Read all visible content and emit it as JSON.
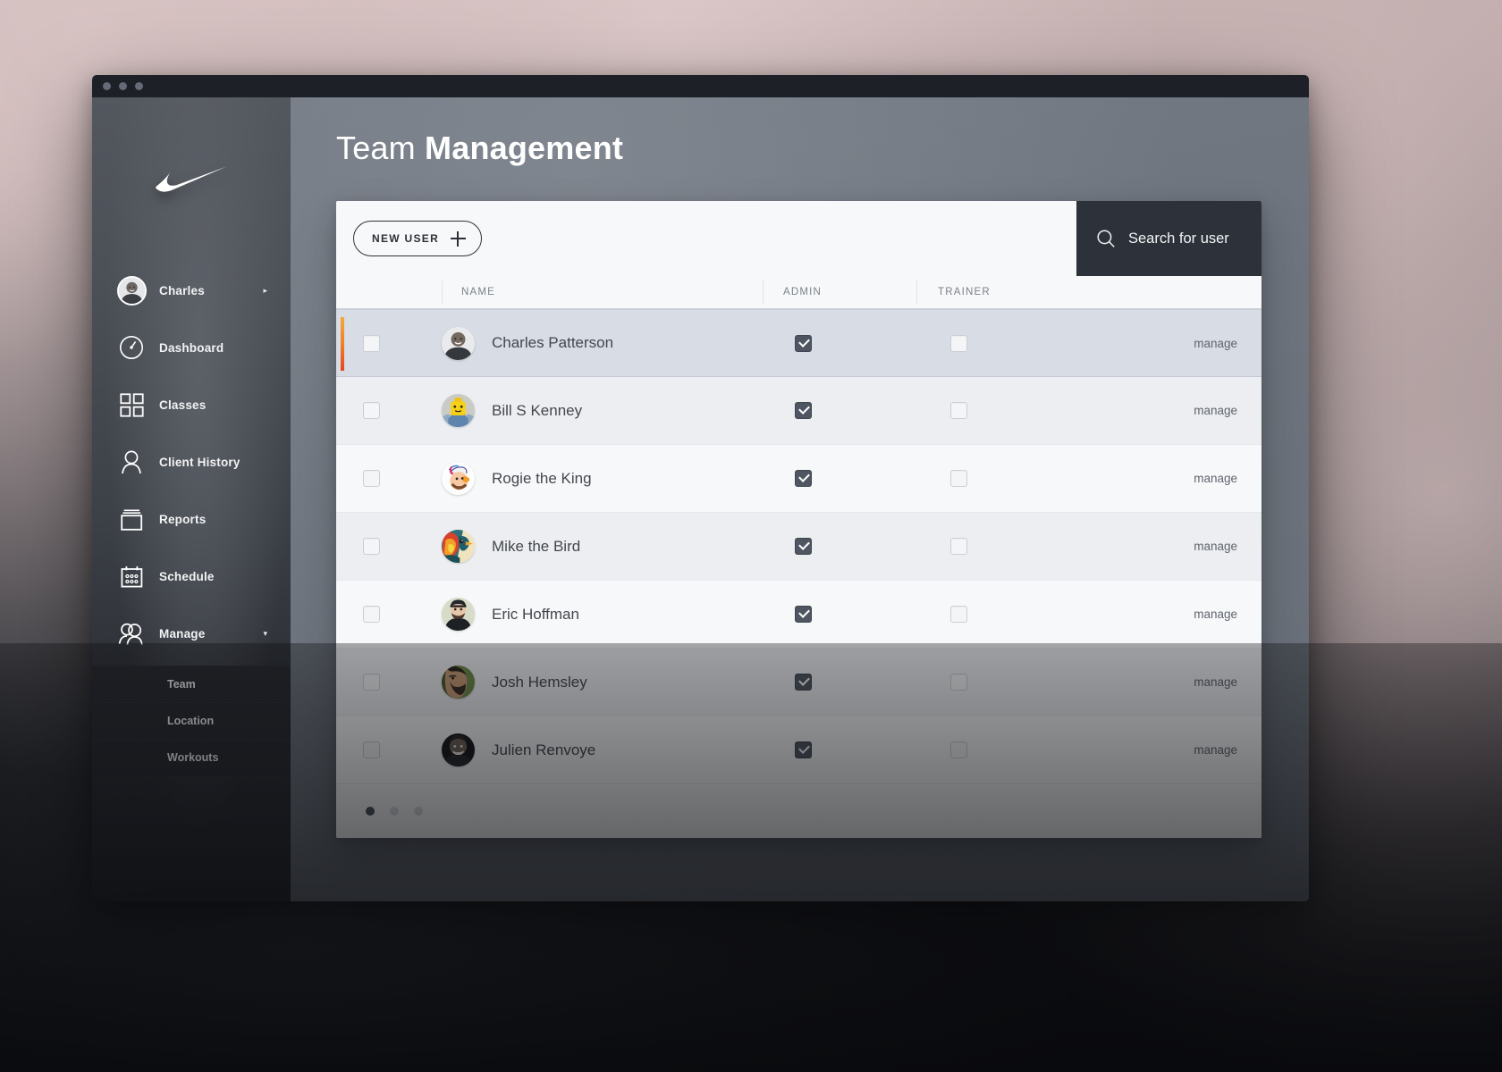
{
  "window": {
    "traffic_lights": [
      "close",
      "minimize",
      "maximize"
    ]
  },
  "sidebar": {
    "logo": "nike-swoosh",
    "items": [
      {
        "label": "Charles",
        "icon": "user-avatar",
        "caret": "▸"
      },
      {
        "label": "Dashboard",
        "icon": "gauge-icon",
        "caret": ""
      },
      {
        "label": "Classes",
        "icon": "grid-icon",
        "caret": ""
      },
      {
        "label": "Client History",
        "icon": "person-icon",
        "caret": ""
      },
      {
        "label": "Reports",
        "icon": "archive-icon",
        "caret": ""
      },
      {
        "label": "Schedule",
        "icon": "calendar-icon",
        "caret": ""
      },
      {
        "label": "Manage",
        "icon": "people-icon",
        "caret": "▾"
      }
    ],
    "submenu": [
      {
        "label": "Team"
      },
      {
        "label": "Location"
      },
      {
        "label": "Workouts"
      }
    ]
  },
  "header": {
    "title_light": "Team",
    "title_bold": "Management"
  },
  "toolbar": {
    "new_user_label": "NEW USER",
    "new_user_icon": "plus-icon",
    "search_icon": "search-icon",
    "search_placeholder": "Search for user",
    "search_value": ""
  },
  "table": {
    "columns": {
      "select": "",
      "name": "NAME",
      "admin": "ADMIN",
      "trainer": "TRAINER",
      "manage": ""
    },
    "manage_label": "manage",
    "rows": [
      {
        "name": "Charles Patterson",
        "selected": true,
        "row_checked": false,
        "admin": true,
        "trainer": false,
        "manage": "manage",
        "avatar": "photo-man-dark-shirt"
      },
      {
        "name": "Bill S Kenney",
        "selected": false,
        "row_checked": false,
        "admin": true,
        "trainer": false,
        "manage": "manage",
        "avatar": "lego-figure"
      },
      {
        "name": "Rogie the King",
        "selected": false,
        "row_checked": false,
        "admin": true,
        "trainer": false,
        "manage": "manage",
        "avatar": "cartoon-bird-hat"
      },
      {
        "name": "Mike the Bird",
        "selected": false,
        "row_checked": false,
        "admin": true,
        "trainer": false,
        "manage": "manage",
        "avatar": "colorful-bird"
      },
      {
        "name": "Eric Hoffman",
        "selected": false,
        "row_checked": false,
        "admin": true,
        "trainer": false,
        "manage": "manage",
        "avatar": "photo-man-beanie"
      },
      {
        "name": "Josh Hemsley",
        "selected": false,
        "row_checked": false,
        "admin": true,
        "trainer": false,
        "manage": "manage",
        "avatar": "photo-man-beard"
      },
      {
        "name": "Julien Renvoye",
        "selected": false,
        "row_checked": false,
        "admin": true,
        "trainer": false,
        "manage": "manage",
        "avatar": "photo-man-grey"
      }
    ]
  },
  "pagination": {
    "dots": 3,
    "active_index": 0
  },
  "colors": {
    "accent_bar_top": "#f0a93c",
    "accent_bar_bottom": "#e8441f",
    "search_panel_bg": "#2c313a",
    "selected_row_bg": "#d7dce5",
    "checkbox_checked_bg": "#4f5662",
    "sidebar_submenu_bg": "#272a30",
    "main_bg": "#6e747e",
    "card_bg": "#f7f8f9"
  }
}
